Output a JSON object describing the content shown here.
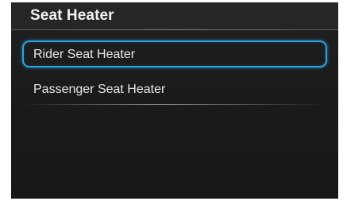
{
  "header": {
    "title": "Seat Heater"
  },
  "menu": {
    "items": [
      {
        "label": "Rider Seat Heater",
        "selected": true
      },
      {
        "label": "Passenger Seat Heater",
        "selected": false
      }
    ]
  },
  "colors": {
    "background": "#1b1b1b",
    "header_background": "#262626",
    "text": "#e9e9e9",
    "selection_border": "#2aa3e3"
  }
}
